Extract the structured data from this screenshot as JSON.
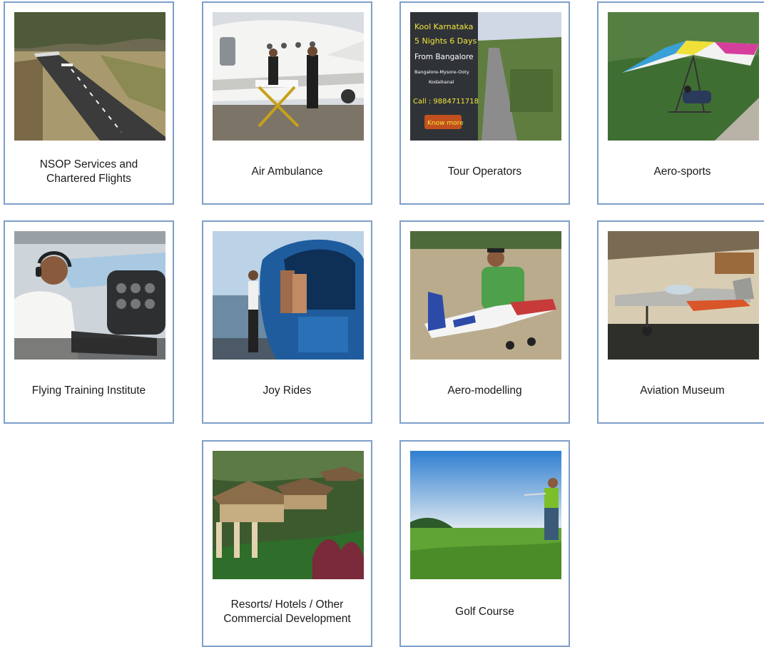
{
  "services": [
    {
      "label": "NSOP Services and\nChartered Flights",
      "image": "runway-photo"
    },
    {
      "label": "Air Ambulance",
      "image": "air-ambulance-photo"
    },
    {
      "label": "Tour Operators",
      "image": "tour-ad-photo"
    },
    {
      "label": "Aero-sports",
      "image": "hang-glider-photo"
    },
    {
      "label": "Flying Training Institute",
      "image": "pilot-cockpit-photo"
    },
    {
      "label": "Joy Rides",
      "image": "helicopter-photo"
    },
    {
      "label": "Aero-modelling",
      "image": "model-plane-photo"
    },
    {
      "label": "Aviation Museum",
      "image": "museum-aircraft-photo"
    },
    {
      "label": "Resorts/ Hotels / Other\nCommercial Development",
      "image": "resort-photo"
    },
    {
      "label": "Golf Course",
      "image": "golfer-photo"
    }
  ],
  "tour_ad": {
    "line1": "Kool Karnataka",
    "line2": "5 Nights 6 Days",
    "line3": "From Bangalore",
    "line4": "Bangalore-Mysore-Ooty",
    "line5": "Kodaikanal",
    "phone": "Call : 9884711718",
    "cta": "Know more"
  },
  "colors": {
    "card_border": "#7f9fca",
    "caption_text": "#1a1a1a",
    "background": "#ffffff"
  }
}
